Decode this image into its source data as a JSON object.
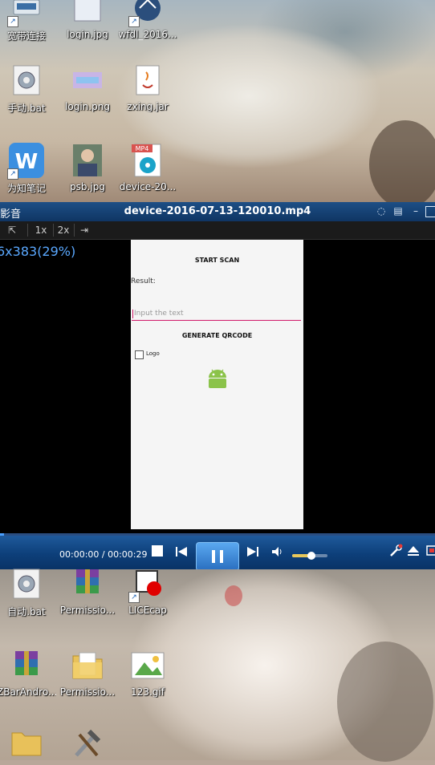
{
  "desktop_top": {
    "icons": [
      {
        "label": "宽带连接",
        "icon": "broadband-connection-icon"
      },
      {
        "label": "login.jpg",
        "icon": "image-file-icon"
      },
      {
        "label": "wfdl_2016...",
        "icon": "app-shortcut-icon"
      },
      {
        "label": "手动.bat",
        "icon": "batch-file-icon"
      },
      {
        "label": "login.png",
        "icon": "image-file-icon"
      },
      {
        "label": "zxing.jar",
        "icon": "java-jar-icon"
      },
      {
        "label": "为知笔记",
        "icon": "wiz-note-icon"
      },
      {
        "label": "psb.jpg",
        "icon": "photo-file-icon"
      },
      {
        "label": "device-20...",
        "icon": "mp4-video-icon",
        "badge": "MP4"
      }
    ]
  },
  "player": {
    "app_name": "影音",
    "title": "device-2016-07-13-120010.mp4",
    "toolbar": {
      "speed_1x": "1x",
      "speed_2x": "2x"
    },
    "resolution_info": "6x383(29%)",
    "progress_fraction": 0.01,
    "time": "00:00:00 / 00:00:29",
    "volume_fraction": 0.55,
    "colors": {
      "title_bar": "#1d4f86",
      "controls": "#0d3f7a",
      "accent": "#4aa0ff"
    }
  },
  "phone_app": {
    "start_scan_label": "START SCAN",
    "result_label": "Result:",
    "input_placeholder": "Input the text",
    "generate_label": "GENERATE QRCODE",
    "logo_label": "Logo",
    "accent_color": "#d01a6a",
    "android_color": "#8bc34a"
  },
  "desktop_bottom": {
    "icons": [
      {
        "label": "自动.bat",
        "icon": "batch-file-icon"
      },
      {
        "label": "Permissio...",
        "icon": "winrar-archive-icon"
      },
      {
        "label": "LICEcap",
        "icon": "licecap-icon"
      },
      {
        "label": "ZBarAndro...",
        "icon": "winrar-archive-icon"
      },
      {
        "label": "Permissio...",
        "icon": "folder-icon"
      },
      {
        "label": "123.gif",
        "icon": "gif-image-icon"
      }
    ]
  }
}
